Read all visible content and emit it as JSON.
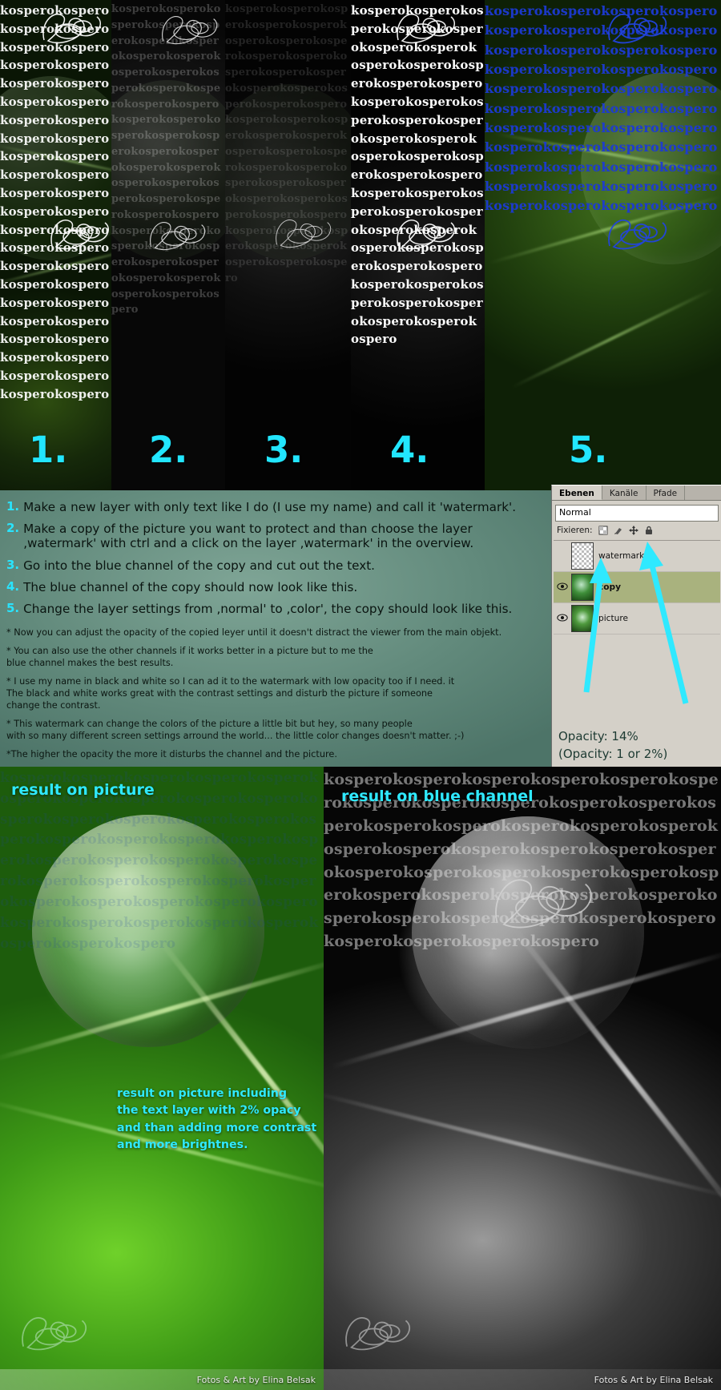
{
  "watermark": {
    "name": "kospero",
    "repeat_text": "kosperokosperokosperokosperokosperokosperokosperokosperokosperokosperokosperokosperokosperokosperokosperokosperokosperokosperokosperokosperokosperokosperokosperokosperokosperokosperokosperokosperokosperokosperokosperokosperokosperokosperokosperokosperokosperokosperokosperokosperokosperokosperokosperokospero"
  },
  "steps_numbers": [
    "1.",
    "2.",
    "3.",
    "4.",
    "5."
  ],
  "instructions": {
    "steps": [
      {
        "num": "1.",
        "text": "Make a new layer with only text like I do (I use my name) and call it 'watermark'."
      },
      {
        "num": "2.",
        "text": "Make a copy of the picture you want to protect and than choose the layer ‚watermark' with ctrl and a click on the layer ‚watermark' in the overview."
      },
      {
        "num": "3.",
        "text": "Go into the blue channel of the copy and cut out the text."
      },
      {
        "num": "4.",
        "text": "The blue channel of the copy should now look like this."
      },
      {
        "num": "5.",
        "text": "Change the layer settings from ‚normal' to ‚color', the copy should look like this."
      }
    ],
    "notes": [
      "* Now you can adjust the opacity of the copied leyer until it doesn't distract the viewer from the main objekt.",
      "* You can also use the other channels if it works better in a picture but to me the\nblue channel makes the best results.",
      "* I use my name in black and white so I can ad it to the watermark with low opacity too if I need. it\nThe black and white works great with the contrast settings and disturb the picture if someone\nchange the contrast.",
      "* This watermark can change the colors of the picture a little bit but hey, so many people\nwith so many different screen settings arround the world... the little color changes doesn't matter. ;-)",
      "*The higher the opacity the more it disturbs the channel and the picture."
    ]
  },
  "layers_palette": {
    "tabs": [
      {
        "label": "Ebenen",
        "active": true
      },
      {
        "label": "Kanäle",
        "active": false
      },
      {
        "label": "Pfade",
        "active": false
      }
    ],
    "blend_mode": "Normal",
    "lock_label": "Fixieren:",
    "lock_icons": [
      "transparency-lock-icon",
      "paint-lock-icon",
      "move-lock-icon",
      "lock-all-icon"
    ],
    "layers": [
      {
        "name": "watermark",
        "visible": false,
        "selected": false,
        "thumb": "checker"
      },
      {
        "name": "copy",
        "visible": true,
        "selected": true,
        "thumb": "leaf-a"
      },
      {
        "name": "picture",
        "visible": true,
        "selected": false,
        "thumb": "leaf-b"
      }
    ],
    "opacity_primary": "Opacity: 14%",
    "opacity_secondary": "(Opacity: 1 or 2%)"
  },
  "results": {
    "left_caption": "result on picture",
    "right_caption": "result on blue channel",
    "left_note": "result on picture including\nthe text layer with 2% opacy\nand than adding more contrast\nand more brightnes.",
    "credit": "Fotos & Art by Elina Belsak"
  },
  "colors": {
    "cyan": "#2fe9ff",
    "panel_green": "#628a7c",
    "blue_channel_text": "#1b39d6",
    "palette_gray": "#d4d0c8",
    "selected_row": "#a9b27e"
  }
}
